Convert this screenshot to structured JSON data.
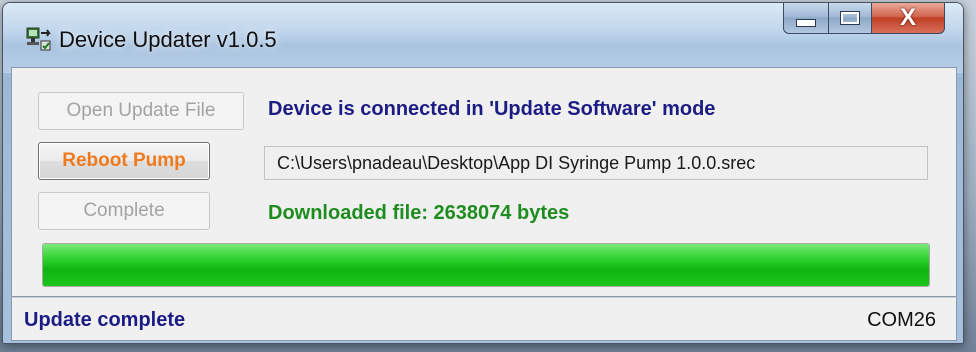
{
  "window": {
    "title": "Device Updater v1.0.5",
    "icon": "device-updater-app-icon",
    "controls": {
      "minimize_icon": "minimize-icon",
      "maximize_icon": "maximize-icon",
      "close_glyph": "X"
    }
  },
  "buttons": {
    "open_update_file": {
      "label": "Open Update File",
      "enabled": false
    },
    "reboot_pump": {
      "label": "Reboot Pump",
      "enabled": true
    },
    "complete": {
      "label": "Complete",
      "enabled": false
    }
  },
  "messages": {
    "connection_status": "Device is connected in 'Update Software' mode",
    "file_path": "C:\\Users\\pnadeau\\Desktop\\App DI Syringe Pump 1.0.0.srec",
    "download_status": "Downloaded file: 2638074 bytes"
  },
  "progress": {
    "fraction": 1.0,
    "color": "#1cc41c"
  },
  "statusbar": {
    "left": "Update complete",
    "right": "COM26"
  },
  "colors": {
    "status_text": "#1c1c84",
    "download_text": "#1f8c1f",
    "reboot_label": "#f07a1c",
    "disabled_label": "#a3a3a3"
  }
}
